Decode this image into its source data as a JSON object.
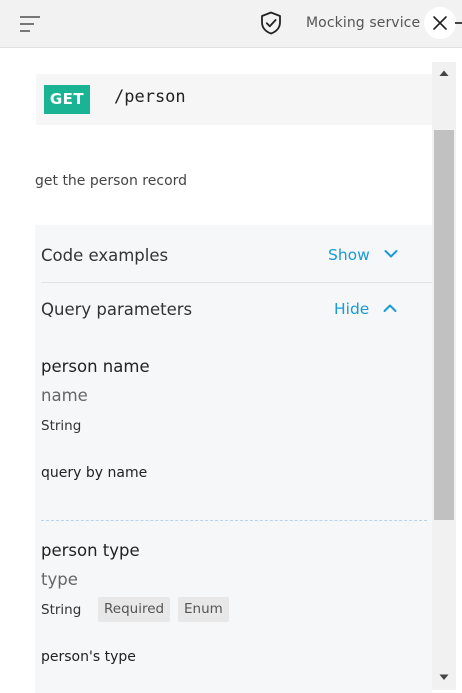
{
  "header": {
    "menu_icon": "hamburger-menu-icon",
    "shield_icon": "shield-check-icon",
    "service_label": "Mocking service",
    "close_icon": "close-icon"
  },
  "endpoint": {
    "method": "GET",
    "path": "/person",
    "description": "get the person record",
    "method_color": "#1ab394"
  },
  "sections": {
    "code_examples": {
      "title": "Code examples",
      "toggle": "Show"
    },
    "query_parameters": {
      "title": "Query parameters",
      "toggle": "Hide"
    }
  },
  "parameters": [
    {
      "display_name": "person name",
      "name": "name",
      "type": "String",
      "description": "query by name",
      "tags": []
    },
    {
      "display_name": "person type",
      "name": "type",
      "type": "String",
      "description": "person's type",
      "tags": [
        "Required",
        "Enum"
      ]
    }
  ],
  "colors": {
    "accent_link": "#1a9ad6",
    "panel_bg": "#f6f7f8",
    "topbar_bg": "#f2f2f2"
  }
}
